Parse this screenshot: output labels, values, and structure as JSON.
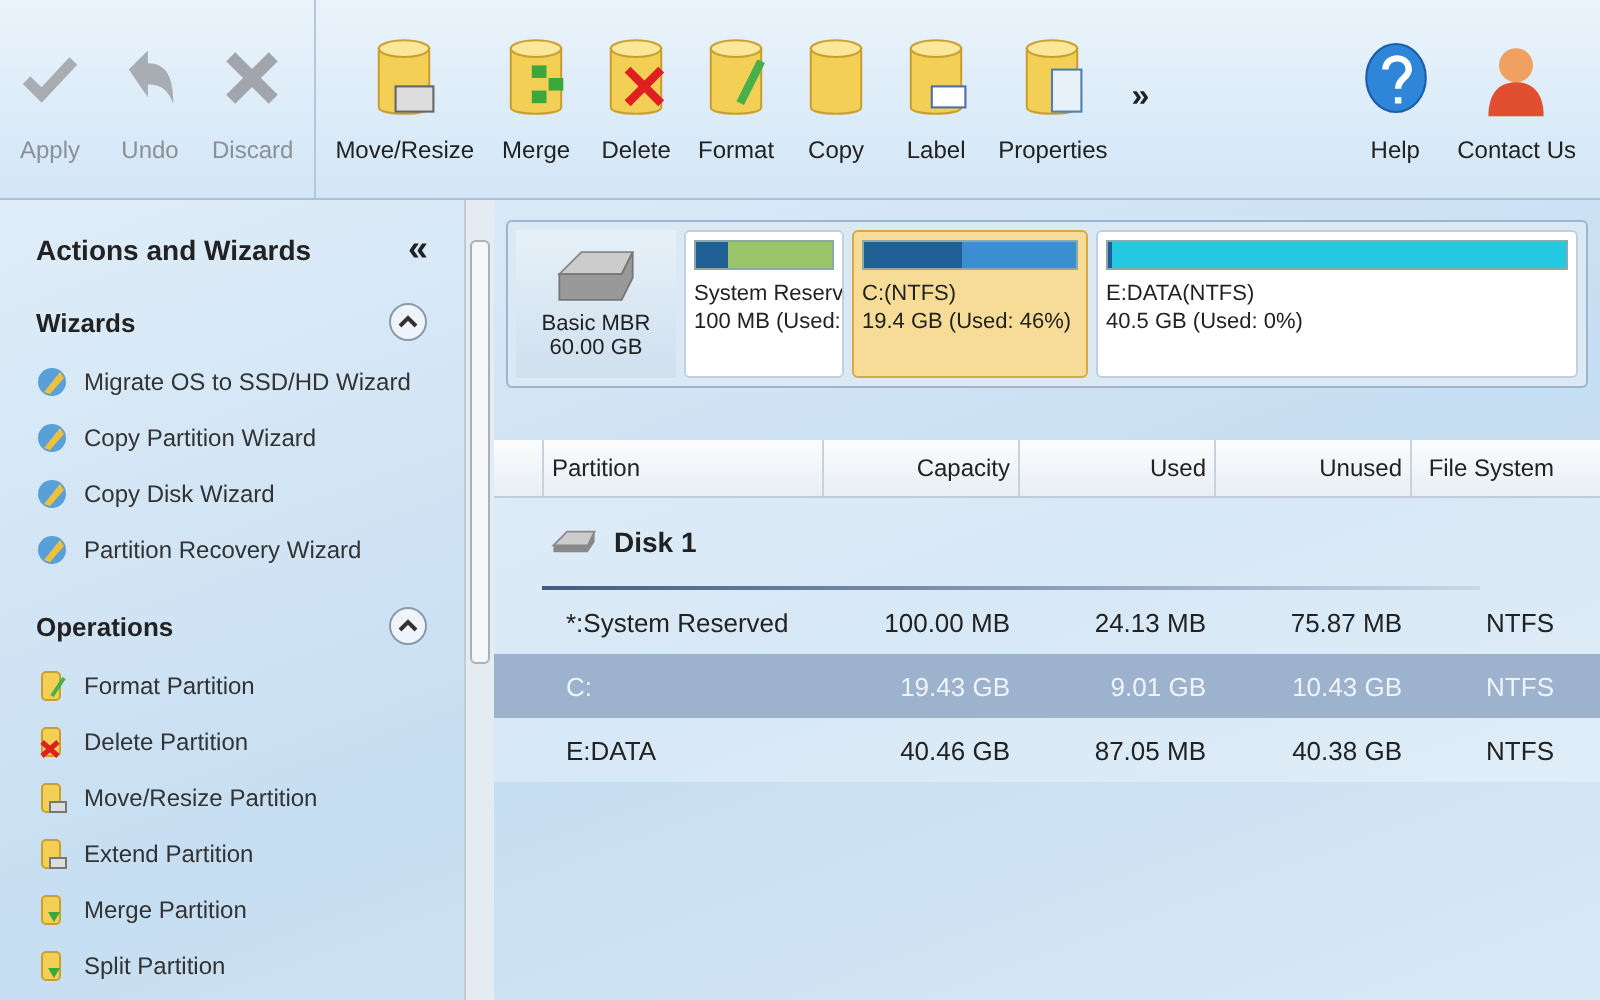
{
  "toolbar": {
    "buttons": [
      {
        "label": "Apply",
        "kind": "check",
        "disabled": true
      },
      {
        "label": "Undo",
        "kind": "undo",
        "disabled": true
      },
      {
        "label": "Discard",
        "kind": "discard",
        "disabled": true
      },
      {
        "label": "Move/Resize",
        "kind": "move",
        "disabled": false
      },
      {
        "label": "Merge",
        "kind": "merge",
        "disabled": false
      },
      {
        "label": "Delete",
        "kind": "delete",
        "disabled": false
      },
      {
        "label": "Format",
        "kind": "format",
        "disabled": false
      },
      {
        "label": "Copy",
        "kind": "copy",
        "disabled": false
      },
      {
        "label": "Label",
        "kind": "label",
        "disabled": false
      },
      {
        "label": "Properties",
        "kind": "properties",
        "disabled": false
      }
    ],
    "more": "»",
    "help_buttons": [
      {
        "label": "Help",
        "kind": "help"
      },
      {
        "label": "Contact Us",
        "kind": "contact"
      }
    ]
  },
  "sidebar": {
    "title": "Actions and Wizards",
    "collapse": "«",
    "sections": [
      {
        "title": "Wizards",
        "expanded": true,
        "items": [
          {
            "label": "Migrate OS to SSD/HD Wizard",
            "kind": "wizard"
          },
          {
            "label": "Copy Partition Wizard",
            "kind": "wizard"
          },
          {
            "label": "Copy Disk Wizard",
            "kind": "wizard"
          },
          {
            "label": "Partition Recovery Wizard",
            "kind": "wizard"
          }
        ]
      },
      {
        "title": "Operations",
        "expanded": true,
        "items": [
          {
            "label": "Format Partition",
            "kind": "format"
          },
          {
            "label": "Delete Partition",
            "kind": "delete"
          },
          {
            "label": "Move/Resize Partition",
            "kind": "move"
          },
          {
            "label": "Extend Partition",
            "kind": "move"
          },
          {
            "label": "Merge Partition",
            "kind": "merge"
          },
          {
            "label": "Split Partition",
            "kind": "merge"
          }
        ]
      }
    ]
  },
  "disk_map": {
    "disk_type": "Basic MBR",
    "disk_size": "60.00 GB",
    "partitions": [
      {
        "name": "System Reserv",
        "info": "100 MB (Used:",
        "level": 0.24,
        "selected": false,
        "color": "#9bc46a"
      },
      {
        "name": "C:(NTFS)",
        "info": "19.4 GB (Used: 46%)",
        "level": 0.46,
        "selected": true,
        "color": "#3a8fd0"
      },
      {
        "name": "E:DATA(NTFS)",
        "info": "40.5 GB (Used: 0%)",
        "level": 0,
        "selected": false,
        "color": "#25c8e2"
      }
    ]
  },
  "table": {
    "columns": [
      "Partition",
      "Capacity",
      "Used",
      "Unused",
      "File System"
    ],
    "disk": "Disk 1",
    "rows": [
      {
        "cells": [
          "*:System Reserved",
          "100.00 MB",
          "24.13 MB",
          "75.87 MB",
          "NTFS"
        ],
        "selected": false
      },
      {
        "cells": [
          "C:",
          "19.43 GB",
          "9.01 GB",
          "10.43 GB",
          "NTFS"
        ],
        "selected": true
      },
      {
        "cells": [
          "E:DATA",
          "40.46 GB",
          "87.05 MB",
          "40.38 GB",
          "NTFS"
        ],
        "selected": false
      }
    ]
  }
}
